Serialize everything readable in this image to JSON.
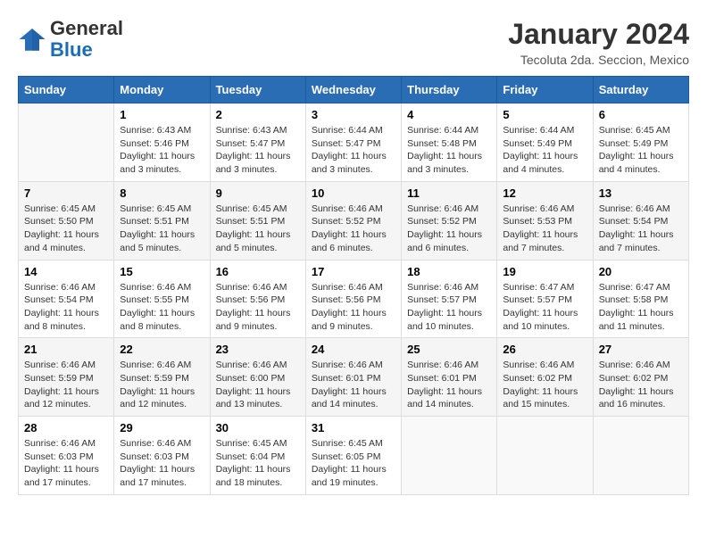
{
  "header": {
    "logo_general": "General",
    "logo_blue": "Blue",
    "title": "January 2024",
    "subtitle": "Tecoluta 2da. Seccion, Mexico"
  },
  "weekdays": [
    "Sunday",
    "Monday",
    "Tuesday",
    "Wednesday",
    "Thursday",
    "Friday",
    "Saturday"
  ],
  "weeks": [
    [
      {
        "day": "",
        "content": ""
      },
      {
        "day": "1",
        "content": "Sunrise: 6:43 AM\nSunset: 5:46 PM\nDaylight: 11 hours\nand 3 minutes."
      },
      {
        "day": "2",
        "content": "Sunrise: 6:43 AM\nSunset: 5:47 PM\nDaylight: 11 hours\nand 3 minutes."
      },
      {
        "day": "3",
        "content": "Sunrise: 6:44 AM\nSunset: 5:47 PM\nDaylight: 11 hours\nand 3 minutes."
      },
      {
        "day": "4",
        "content": "Sunrise: 6:44 AM\nSunset: 5:48 PM\nDaylight: 11 hours\nand 3 minutes."
      },
      {
        "day": "5",
        "content": "Sunrise: 6:44 AM\nSunset: 5:49 PM\nDaylight: 11 hours\nand 4 minutes."
      },
      {
        "day": "6",
        "content": "Sunrise: 6:45 AM\nSunset: 5:49 PM\nDaylight: 11 hours\nand 4 minutes."
      }
    ],
    [
      {
        "day": "7",
        "content": "Sunrise: 6:45 AM\nSunset: 5:50 PM\nDaylight: 11 hours\nand 4 minutes."
      },
      {
        "day": "8",
        "content": "Sunrise: 6:45 AM\nSunset: 5:51 PM\nDaylight: 11 hours\nand 5 minutes."
      },
      {
        "day": "9",
        "content": "Sunrise: 6:45 AM\nSunset: 5:51 PM\nDaylight: 11 hours\nand 5 minutes."
      },
      {
        "day": "10",
        "content": "Sunrise: 6:46 AM\nSunset: 5:52 PM\nDaylight: 11 hours\nand 6 minutes."
      },
      {
        "day": "11",
        "content": "Sunrise: 6:46 AM\nSunset: 5:52 PM\nDaylight: 11 hours\nand 6 minutes."
      },
      {
        "day": "12",
        "content": "Sunrise: 6:46 AM\nSunset: 5:53 PM\nDaylight: 11 hours\nand 7 minutes."
      },
      {
        "day": "13",
        "content": "Sunrise: 6:46 AM\nSunset: 5:54 PM\nDaylight: 11 hours\nand 7 minutes."
      }
    ],
    [
      {
        "day": "14",
        "content": "Sunrise: 6:46 AM\nSunset: 5:54 PM\nDaylight: 11 hours\nand 8 minutes."
      },
      {
        "day": "15",
        "content": "Sunrise: 6:46 AM\nSunset: 5:55 PM\nDaylight: 11 hours\nand 8 minutes."
      },
      {
        "day": "16",
        "content": "Sunrise: 6:46 AM\nSunset: 5:56 PM\nDaylight: 11 hours\nand 9 minutes."
      },
      {
        "day": "17",
        "content": "Sunrise: 6:46 AM\nSunset: 5:56 PM\nDaylight: 11 hours\nand 9 minutes."
      },
      {
        "day": "18",
        "content": "Sunrise: 6:46 AM\nSunset: 5:57 PM\nDaylight: 11 hours\nand 10 minutes."
      },
      {
        "day": "19",
        "content": "Sunrise: 6:47 AM\nSunset: 5:57 PM\nDaylight: 11 hours\nand 10 minutes."
      },
      {
        "day": "20",
        "content": "Sunrise: 6:47 AM\nSunset: 5:58 PM\nDaylight: 11 hours\nand 11 minutes."
      }
    ],
    [
      {
        "day": "21",
        "content": "Sunrise: 6:46 AM\nSunset: 5:59 PM\nDaylight: 11 hours\nand 12 minutes."
      },
      {
        "day": "22",
        "content": "Sunrise: 6:46 AM\nSunset: 5:59 PM\nDaylight: 11 hours\nand 12 minutes."
      },
      {
        "day": "23",
        "content": "Sunrise: 6:46 AM\nSunset: 6:00 PM\nDaylight: 11 hours\nand 13 minutes."
      },
      {
        "day": "24",
        "content": "Sunrise: 6:46 AM\nSunset: 6:01 PM\nDaylight: 11 hours\nand 14 minutes."
      },
      {
        "day": "25",
        "content": "Sunrise: 6:46 AM\nSunset: 6:01 PM\nDaylight: 11 hours\nand 14 minutes."
      },
      {
        "day": "26",
        "content": "Sunrise: 6:46 AM\nSunset: 6:02 PM\nDaylight: 11 hours\nand 15 minutes."
      },
      {
        "day": "27",
        "content": "Sunrise: 6:46 AM\nSunset: 6:02 PM\nDaylight: 11 hours\nand 16 minutes."
      }
    ],
    [
      {
        "day": "28",
        "content": "Sunrise: 6:46 AM\nSunset: 6:03 PM\nDaylight: 11 hours\nand 17 minutes."
      },
      {
        "day": "29",
        "content": "Sunrise: 6:46 AM\nSunset: 6:03 PM\nDaylight: 11 hours\nand 17 minutes."
      },
      {
        "day": "30",
        "content": "Sunrise: 6:45 AM\nSunset: 6:04 PM\nDaylight: 11 hours\nand 18 minutes."
      },
      {
        "day": "31",
        "content": "Sunrise: 6:45 AM\nSunset: 6:05 PM\nDaylight: 11 hours\nand 19 minutes."
      },
      {
        "day": "",
        "content": ""
      },
      {
        "day": "",
        "content": ""
      },
      {
        "day": "",
        "content": ""
      }
    ]
  ]
}
